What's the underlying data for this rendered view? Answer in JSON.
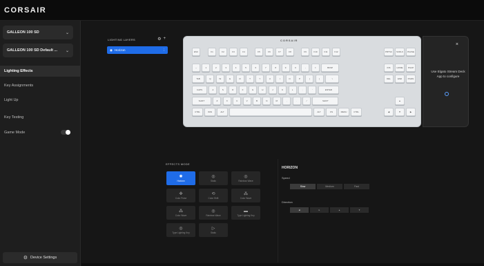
{
  "app": {
    "brand": "CORSAIR"
  },
  "sidebar": {
    "device_select": "GALLEON 100 SD",
    "profile_select": "GALLEON 100 SD Default ...",
    "items": [
      {
        "label": "Lighting Effects",
        "active": true
      },
      {
        "label": "Key Assignments",
        "active": false
      },
      {
        "label": "Light Up",
        "active": false
      },
      {
        "label": "Key Testing",
        "active": false
      },
      {
        "label": "Game Mode",
        "active": false
      }
    ],
    "game_mode_on": true,
    "device_settings": "Device Settings"
  },
  "lighting_layers": {
    "heading": "LIGHTING LAYERS",
    "layer_name": "Horizon"
  },
  "keyboard": {
    "brand": "CORSAIR",
    "row0": [
      "ESC",
      "F1",
      "F2",
      "F3",
      "F4",
      "F5",
      "F6",
      "F7",
      "F8",
      "F9",
      "F10",
      "F11",
      "F12"
    ],
    "row0_nav": [
      "PRTSC",
      "SCRLK",
      "PAUSE"
    ],
    "row1": [
      "~",
      "1",
      "2",
      "3",
      "4",
      "5",
      "6",
      "7",
      "8",
      "9",
      "0",
      "-",
      "=",
      "BKSP"
    ],
    "row1_nav": [
      "INS",
      "HOME",
      "PGUP"
    ],
    "row2": [
      "TAB",
      "Q",
      "W",
      "E",
      "R",
      "T",
      "Y",
      "U",
      "I",
      "O",
      "P",
      "[",
      "]",
      "\\"
    ],
    "row2_nav": [
      "DEL",
      "END",
      "PGDN"
    ],
    "row3": [
      "CAPS",
      "A",
      "S",
      "D",
      "F",
      "G",
      "H",
      "J",
      "K",
      "L",
      ";",
      "'",
      "ENTER"
    ],
    "row4": [
      "SHIFT",
      "Z",
      "X",
      "C",
      "V",
      "B",
      "N",
      "M",
      ",",
      ".",
      "/",
      "SHIFT"
    ],
    "row5": [
      "CTRL",
      "WIN",
      "ALT",
      "",
      "ALT",
      "FN",
      "MENU",
      "CTRL"
    ],
    "arrows": [
      "▲",
      "◀",
      "▼",
      "▶"
    ],
    "side_panel_text": "Use Elgato Stream Deck App to configure",
    "close": "×"
  },
  "effects": {
    "heading": "EFFECTS MODE",
    "items": [
      {
        "label": "Horizon",
        "icon": "✺",
        "selected": true
      },
      {
        "label": "Static",
        "icon": "◎",
        "selected": false
      },
      {
        "label": "Rainbow Wave",
        "icon": "◎",
        "selected": false
      },
      {
        "label": "Color Pulse",
        "icon": "✜",
        "selected": false
      },
      {
        "label": "Color Shift",
        "icon": "⟲",
        "selected": false
      },
      {
        "label": "Color Wave",
        "icon": "⁂",
        "selected": false
      },
      {
        "label": "Color Wave",
        "icon": "⁂",
        "selected": false
      },
      {
        "label": "Rainbow Wave",
        "icon": "◎",
        "selected": false
      },
      {
        "label": "Type Lighting Key",
        "icon": "▬",
        "selected": false
      },
      {
        "label": "Type Lighting Key",
        "icon": "◎",
        "selected": false
      },
      {
        "label": "Static",
        "icon": "▷",
        "selected": false
      }
    ]
  },
  "horizon": {
    "title": "HORIZON",
    "speed_label": "Speed",
    "speed_options": [
      "Slow",
      "Medium",
      "Fast"
    ],
    "speed_selected": 0,
    "direction_label": "Direction",
    "direction_options": [
      "◂",
      "▸",
      "▴",
      "▾"
    ],
    "direction_selected": 0
  },
  "colors": {
    "accent": "#1f6ce8",
    "sidebar_bg": "#1e1e1e",
    "main_bg": "#161616",
    "keycap": "#f4f5f6"
  }
}
